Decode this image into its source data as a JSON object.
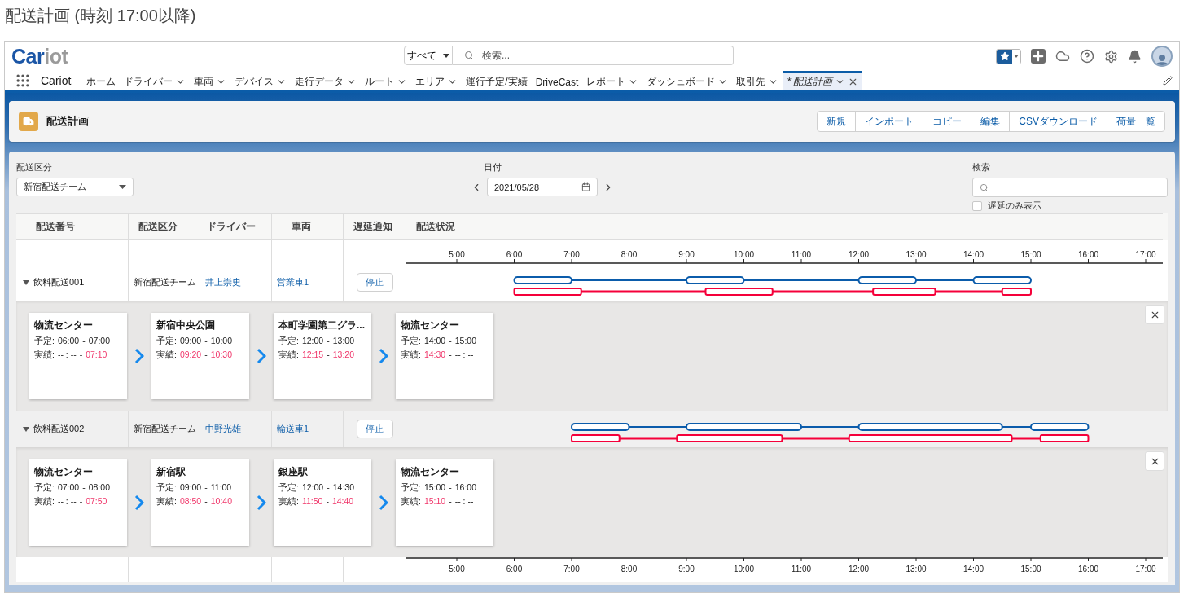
{
  "page_title": "配送計画 (時刻 17:00以降)",
  "header": {
    "logo_parts": [
      "Car",
      "iot"
    ],
    "search_scope": "すべて",
    "search_placeholder": "検索..."
  },
  "nav": {
    "app_name": "Cariot",
    "items": [
      {
        "label": "ホーム",
        "menu": false,
        "closable": false,
        "selected": false
      },
      {
        "label": "ドライバー",
        "menu": true,
        "closable": false,
        "selected": false
      },
      {
        "label": "車両",
        "menu": true,
        "closable": false,
        "selected": false
      },
      {
        "label": "デバイス",
        "menu": true,
        "closable": false,
        "selected": false
      },
      {
        "label": "走行データ",
        "menu": true,
        "closable": false,
        "selected": false
      },
      {
        "label": "ルート",
        "menu": true,
        "closable": false,
        "selected": false
      },
      {
        "label": "エリア",
        "menu": true,
        "closable": false,
        "selected": false
      },
      {
        "label": "運行予定/実績",
        "menu": false,
        "closable": false,
        "selected": false
      },
      {
        "label": "DriveCast",
        "menu": false,
        "closable": false,
        "selected": false
      },
      {
        "label": "レポート",
        "menu": true,
        "closable": false,
        "selected": false
      },
      {
        "label": "ダッシュボード",
        "menu": true,
        "closable": false,
        "selected": false
      },
      {
        "label": "取引先",
        "menu": true,
        "closable": false,
        "selected": false
      },
      {
        "label": "* 配送計画",
        "menu": true,
        "closable": true,
        "selected": true
      }
    ]
  },
  "page_header": {
    "title": "配送計画",
    "buttons": [
      "新規",
      "インポート",
      "コピー",
      "編集",
      "CSVダウンロード",
      "荷量一覧"
    ]
  },
  "filters": {
    "category": {
      "label": "配送区分",
      "value": "新宿配送チーム"
    },
    "date": {
      "label": "日付",
      "value": "2021/05/28"
    },
    "search": {
      "label": "検索"
    },
    "delayed_only": {
      "label": "遅延のみ表示",
      "checked": false
    }
  },
  "table": {
    "columns": [
      "配送番号",
      "配送区分",
      "ドライバー",
      "車両",
      "遅延通知",
      "配送状況"
    ],
    "axis_ticks_bottom": [
      "5:00",
      "6:00",
      "7:00",
      "8:00",
      "9:00",
      "10:00",
      "11:00",
      "12:00",
      "13:00",
      "14:00",
      "15:00",
      "16:00",
      "17:00"
    ],
    "axis_ticks": [
      "5:00",
      "6:00",
      "7:00",
      "8:00",
      "9:00",
      "10:00",
      "11:00",
      "12:00",
      "13:00",
      "14:00",
      "15:00",
      "16:00",
      "17:00"
    ],
    "rows": [
      {
        "number": "飲料配送001",
        "category": "新宿配送チーム",
        "driver": "井上崇史",
        "vehicle": "営業車1",
        "notify_button": "停止",
        "expanded": true,
        "highlighted": false,
        "stops": [
          {
            "name": "物流センター",
            "plan": {
              "label": "予定:",
              "start": "06:00",
              "sep": "-",
              "end": "07:00"
            },
            "actual": {
              "label": "実績:",
              "start": "-- : --",
              "start_recorded": false,
              "sep": "-",
              "end": "07:10",
              "end_recorded": true
            }
          },
          {
            "name": "新宿中央公園",
            "plan": {
              "label": "予定:",
              "start": "09:00",
              "sep": "-",
              "end": "10:00"
            },
            "actual": {
              "label": "実績:",
              "start": "09:20",
              "start_recorded": true,
              "sep": "-",
              "end": "10:30",
              "end_recorded": true
            }
          },
          {
            "name": "本町学園第二グラ...",
            "plan": {
              "label": "予定:",
              "start": "12:00",
              "sep": "-",
              "end": "13:00"
            },
            "actual": {
              "label": "実績:",
              "start": "12:15",
              "start_recorded": true,
              "sep": "-",
              "end": "13:20",
              "end_recorded": true
            }
          },
          {
            "name": "物流センター",
            "plan": {
              "label": "予定:",
              "start": "14:00",
              "sep": "-",
              "end": "15:00"
            },
            "actual": {
              "label": "実績:",
              "start": "14:30",
              "start_recorded": true,
              "sep": "-",
              "end": "-- : --",
              "end_recorded": false
            }
          }
        ]
      },
      {
        "number": "飲料配送002",
        "category": "新宿配送チーム",
        "driver": "中野光雄",
        "vehicle": "輸送車1",
        "notify_button": "停止",
        "expanded": true,
        "highlighted": true,
        "stops": [
          {
            "name": "物流センター",
            "plan": {
              "label": "予定:",
              "start": "07:00",
              "sep": "-",
              "end": "08:00"
            },
            "actual": {
              "label": "実績:",
              "start": "-- : --",
              "start_recorded": false,
              "sep": "-",
              "end": "07:50",
              "end_recorded": true
            }
          },
          {
            "name": "新宿駅",
            "plan": {
              "label": "予定:",
              "start": "09:00",
              "sep": "-",
              "end": "11:00"
            },
            "actual": {
              "label": "実績:",
              "start": "08:50",
              "start_recorded": true,
              "sep": "-",
              "end": "10:40",
              "end_recorded": true
            }
          },
          {
            "name": "銀座駅",
            "plan": {
              "label": "予定:",
              "start": "12:00",
              "sep": "-",
              "end": "14:30"
            },
            "actual": {
              "label": "実績:",
              "start": "11:50",
              "start_recorded": true,
              "sep": "-",
              "end": "14:40",
              "end_recorded": true
            }
          },
          {
            "name": "物流センター",
            "plan": {
              "label": "予定:",
              "start": "15:00",
              "sep": "-",
              "end": "16:00"
            },
            "actual": {
              "label": "実績:",
              "start": "15:10",
              "start_recorded": true,
              "sep": "-",
              "end": "-- : --",
              "end_recorded": false
            }
          }
        ]
      }
    ]
  }
}
